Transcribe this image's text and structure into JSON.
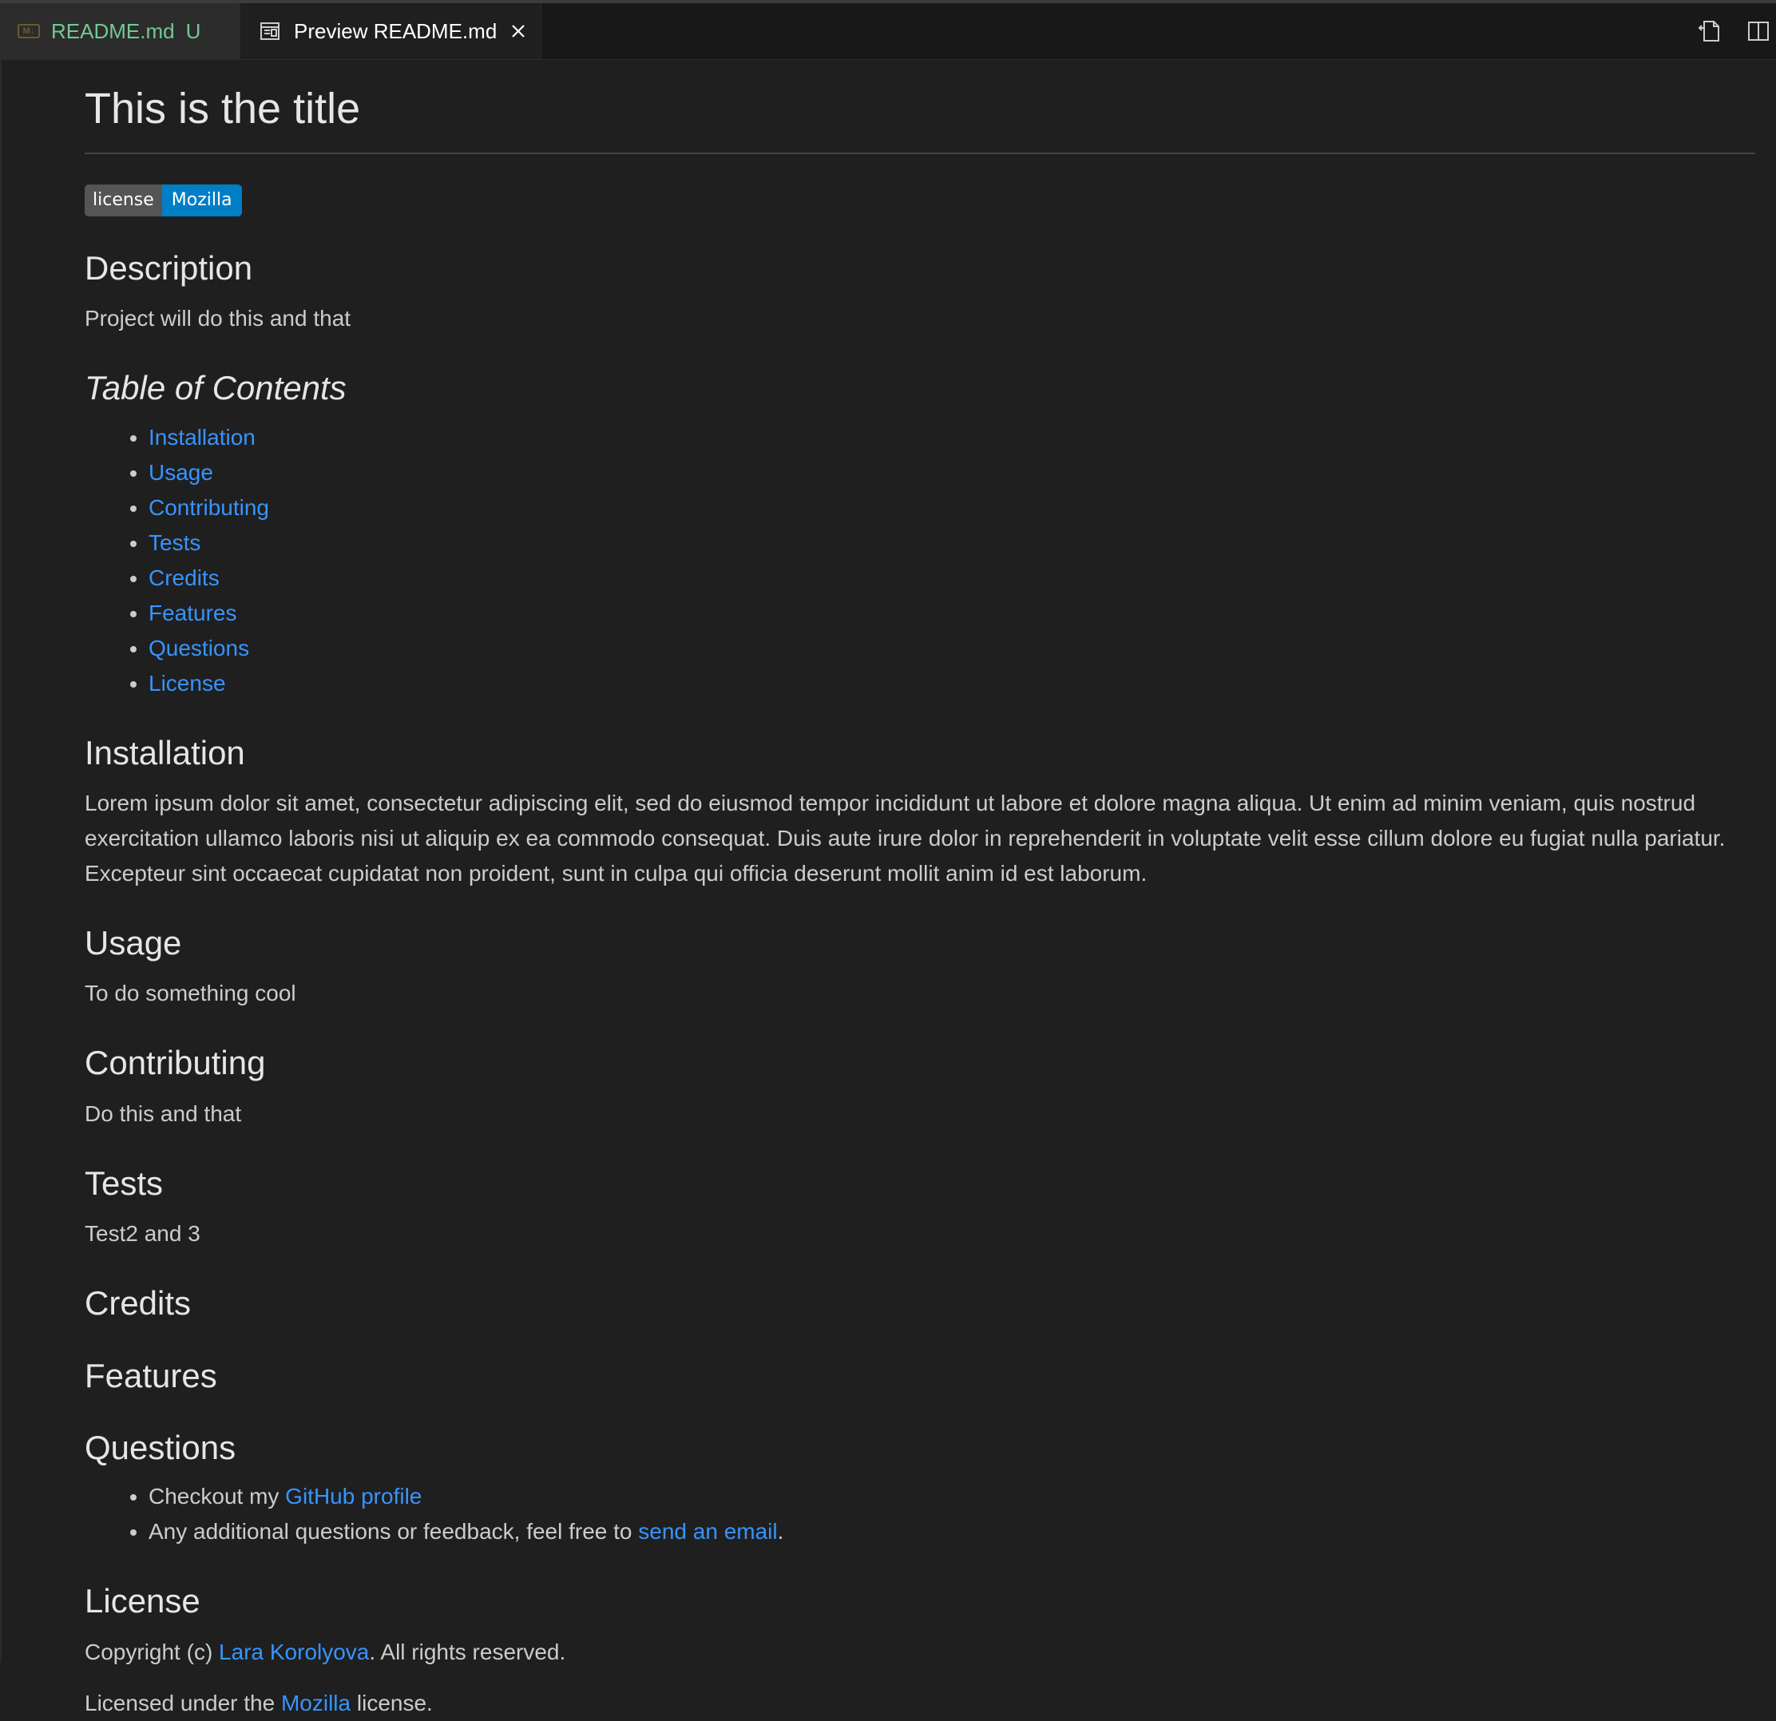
{
  "tabs": {
    "inactive": {
      "icon": "M↓",
      "name": "README.md",
      "status": "U"
    },
    "active": {
      "name": "Preview README.md"
    }
  },
  "doc": {
    "title": "This is the title",
    "badge": {
      "left": "license",
      "right": "Mozilla"
    },
    "description": {
      "heading": "Description",
      "text": "Project will do this and that"
    },
    "toc": {
      "heading": "Table of Contents",
      "items": [
        "Installation",
        "Usage",
        "Contributing",
        "Tests",
        "Credits",
        "Features",
        "Questions",
        "License"
      ]
    },
    "installation": {
      "heading": "Installation",
      "text": "Lorem ipsum dolor sit amet, consectetur adipiscing elit, sed do eiusmod tempor incididunt ut labore et dolore magna aliqua. Ut enim ad minim veniam, quis nostrud exercitation ullamco laboris nisi ut aliquip ex ea commodo consequat. Duis aute irure dolor in reprehenderit in voluptate velit esse cillum dolore eu fugiat nulla pariatur. Excepteur sint occaecat cupidatat non proident, sunt in culpa qui officia deserunt mollit anim id est laborum."
    },
    "usage": {
      "heading": "Usage",
      "text": "To do something cool"
    },
    "contributing": {
      "heading": "Contributing",
      "text": "Do this and that"
    },
    "tests": {
      "heading": "Tests",
      "text": "Test2 and 3"
    },
    "credits": {
      "heading": "Credits"
    },
    "features": {
      "heading": "Features"
    },
    "questions": {
      "heading": "Questions",
      "item1_prefix": "Checkout my ",
      "item1_link": "GitHub profile",
      "item2_prefix": "Any additional questions or feedback, feel free to ",
      "item2_link": "send an email",
      "item2_suffix": "."
    },
    "license": {
      "heading": "License",
      "copyright_prefix": "Copyright (c) ",
      "copyright_link": "Lara Korolyova",
      "copyright_suffix": ". All rights reserved.",
      "licensed_prefix": "Licensed under the ",
      "licensed_link": "Mozilla",
      "licensed_suffix": " license."
    }
  },
  "icons": {
    "markdown": "markdown-icon",
    "preview": "preview-icon",
    "close": "close-icon",
    "open-source": "open-source-icon",
    "split-editor": "split-editor-icon"
  },
  "colors": {
    "background": "#1f1f1f",
    "link": "#3794ff",
    "untracked": "#73c991",
    "badge_left": "#555555",
    "badge_right": "#007ec6"
  }
}
